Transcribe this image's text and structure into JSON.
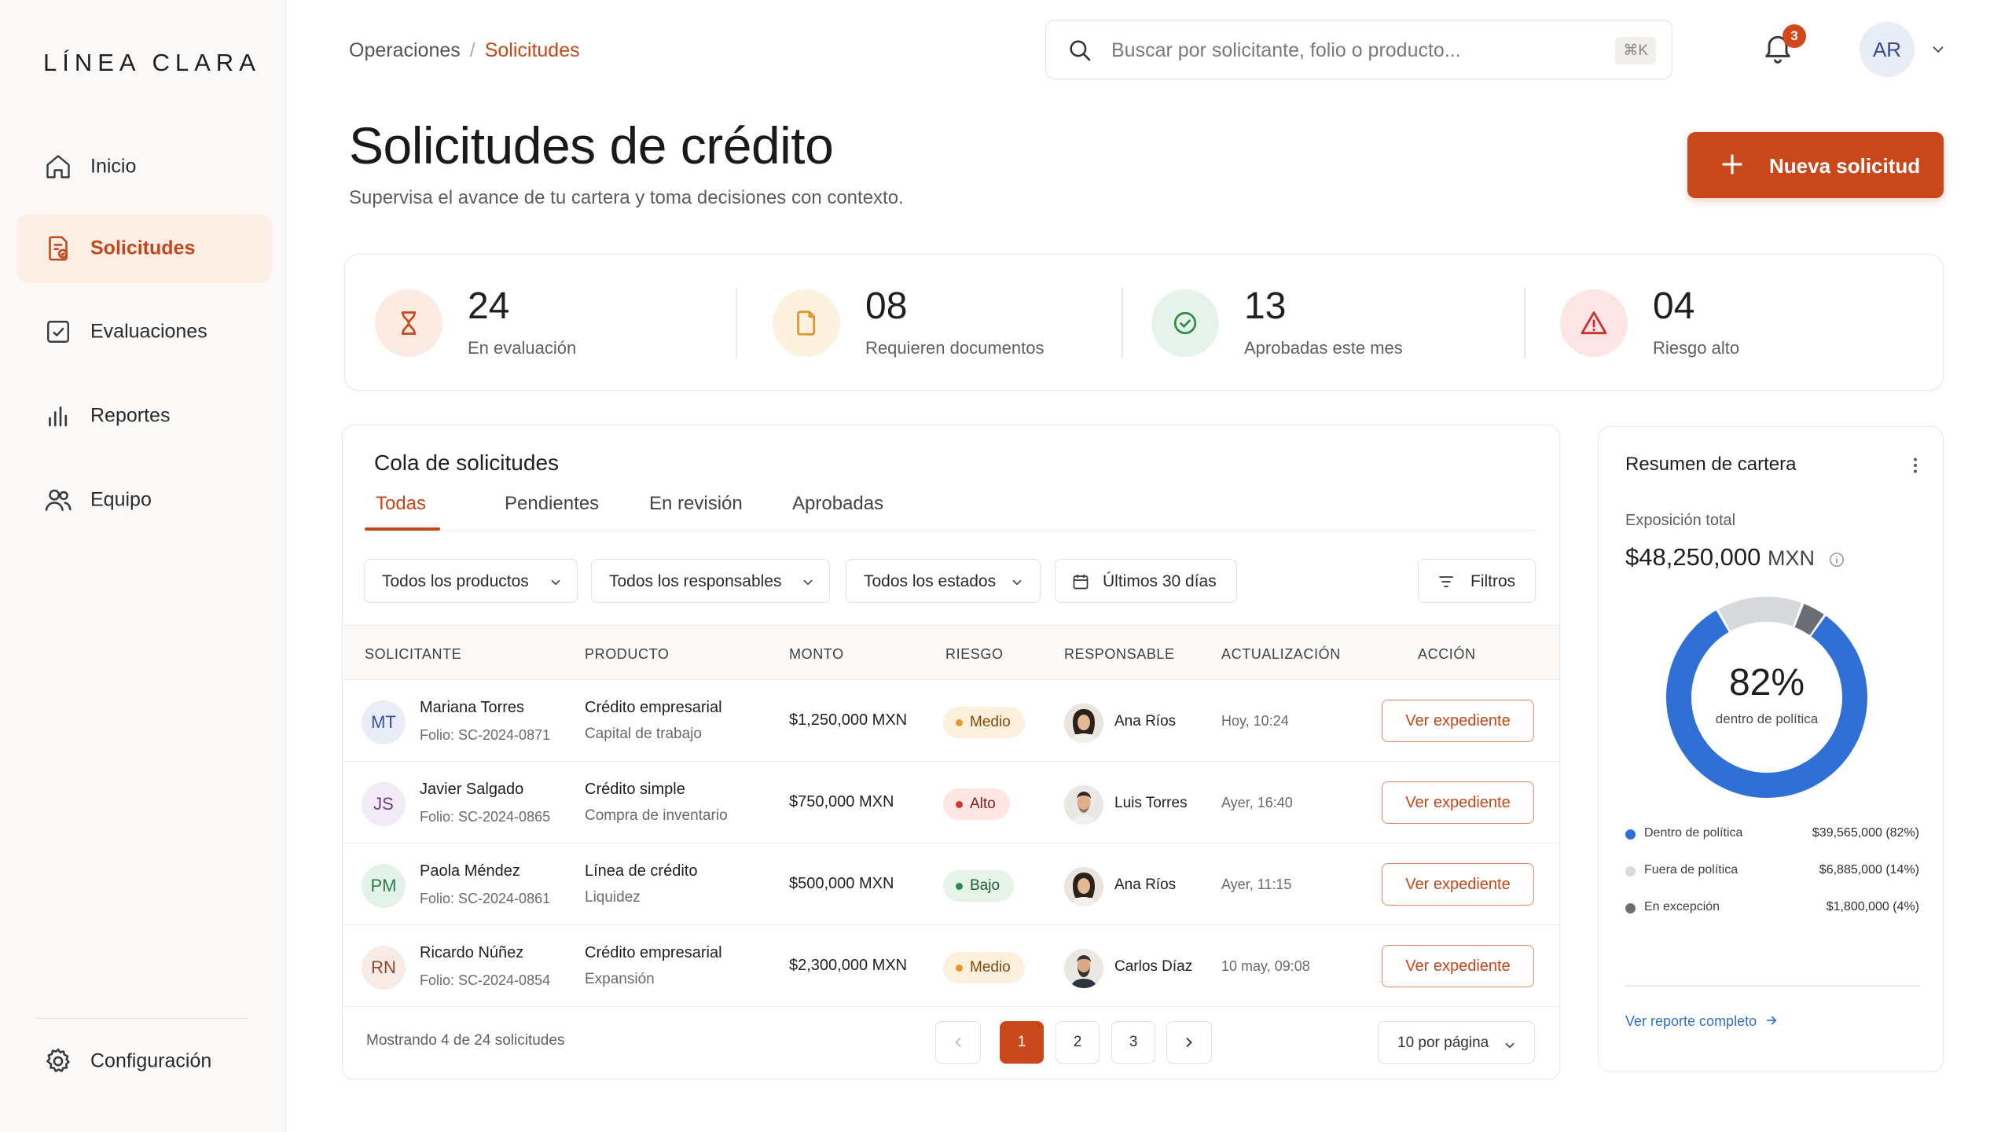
{
  "brand": {
    "logo": "LÍNEA CLARA"
  },
  "sidebar": {
    "items": [
      {
        "label": "Inicio",
        "icon": "home-icon"
      },
      {
        "label": "Solicitudes",
        "icon": "document-icon",
        "active": true
      },
      {
        "label": "Evaluaciones",
        "icon": "checkbox-icon"
      },
      {
        "label": "Reportes",
        "icon": "bar-chart-icon"
      },
      {
        "label": "Equipo",
        "icon": "users-icon"
      }
    ],
    "settings": {
      "label": "Configuración",
      "icon": "gear-icon"
    }
  },
  "header": {
    "breadcrumb": {
      "parent": "Operaciones",
      "separator": "/",
      "current": "Solicitudes"
    },
    "search": {
      "placeholder": "Buscar por solicitante, folio o producto...",
      "shortcut": "⌘K"
    },
    "notifications": {
      "count": "3"
    },
    "user": {
      "initials": "AR"
    }
  },
  "page": {
    "title": "Solicitudes de crédito",
    "subtitle": "Supervisa el avance de tu cartera y toma decisiones con contexto.",
    "new_button": "Nueva solicitud"
  },
  "kpis": [
    {
      "value": "24",
      "label": "En evaluación",
      "icon": "hourglass-icon",
      "color": "#c9481b"
    },
    {
      "value": "08",
      "label": "Requieren documentos",
      "icon": "file-icon",
      "color": "#d9962b"
    },
    {
      "value": "13",
      "label": "Aprobadas este mes",
      "icon": "check-circle-icon",
      "color": "#2f8a4a"
    },
    {
      "value": "04",
      "label": "Riesgo alto",
      "icon": "warning-icon",
      "color": "#c8322e"
    }
  ],
  "queue": {
    "title": "Cola de solicitudes",
    "tabs": [
      "Todas",
      "Pendientes",
      "En revisión",
      "Aprobadas"
    ],
    "filters": {
      "product": "Todos los productos",
      "owner": "Todos los responsables",
      "status": "Todos los estados",
      "date": "Últimos 30 días",
      "more": "Filtros"
    },
    "columns": [
      "SOLICITANTE",
      "PRODUCTO",
      "MONTO",
      "RIESGO",
      "RESPONSABLE",
      "ACTUALIZACIÓN",
      "ACCIÓN"
    ],
    "rows": [
      {
        "initials": "MT",
        "name": "Mariana Torres",
        "folio": "Folio: SC-2024-0871",
        "product": "Crédito empresarial",
        "purpose": "Capital de trabajo",
        "amount": "$1,250,000 MXN",
        "risk": "Medio",
        "owner": "Ana Ríos",
        "updated": "Hoy, 10:24",
        "action": "Ver expediente"
      },
      {
        "initials": "JS",
        "name": "Javier Salgado",
        "folio": "Folio: SC-2024-0865",
        "product": "Crédito simple",
        "purpose": "Compra de inventario",
        "amount": "$750,000 MXN",
        "risk": "Alto",
        "owner": "Luis Torres",
        "updated": "Ayer, 16:40",
        "action": "Ver expediente"
      },
      {
        "initials": "PM",
        "name": "Paola Méndez",
        "folio": "Folio: SC-2024-0861",
        "product": "Línea de crédito",
        "purpose": "Liquidez",
        "amount": "$500,000 MXN",
        "risk": "Bajo",
        "owner": "Ana Ríos",
        "updated": "Ayer, 11:15",
        "action": "Ver expediente"
      },
      {
        "initials": "RN",
        "name": "Ricardo Núñez",
        "folio": "Folio: SC-2024-0854",
        "product": "Crédito empresarial",
        "purpose": "Expansión",
        "amount": "$2,300,000 MXN",
        "risk": "Medio",
        "owner": "Carlos Díaz",
        "updated": "10 may, 09:08",
        "action": "Ver expediente"
      }
    ],
    "footer": {
      "showing": "Mostrando 4 de 24 solicitudes",
      "pages": [
        "1",
        "2",
        "3"
      ],
      "current_page": "1",
      "per_page": "10 por página"
    }
  },
  "portfolio": {
    "title": "Resumen de cartera",
    "exposure_label": "Exposición total",
    "exposure_amount": "$48,250,000",
    "exposure_currency": "MXN",
    "center_value": "82%",
    "center_label": "dentro de política",
    "segments": [
      {
        "name": "Dentro de política",
        "value": "$39,565,000 (82%)",
        "percent": 82,
        "color": "#2f6fd6"
      },
      {
        "name": "Fuera de política",
        "value": "$6,885,000 (14%)",
        "percent": 14,
        "color": "#d7d9dd"
      },
      {
        "name": "En excepción",
        "value": "$1,800,000 (4%)",
        "percent": 4,
        "color": "#6b6f75"
      }
    ],
    "link": "Ver reporte completo"
  },
  "colors": {
    "accent": "#c9481b",
    "blue": "#2f6fd6"
  }
}
